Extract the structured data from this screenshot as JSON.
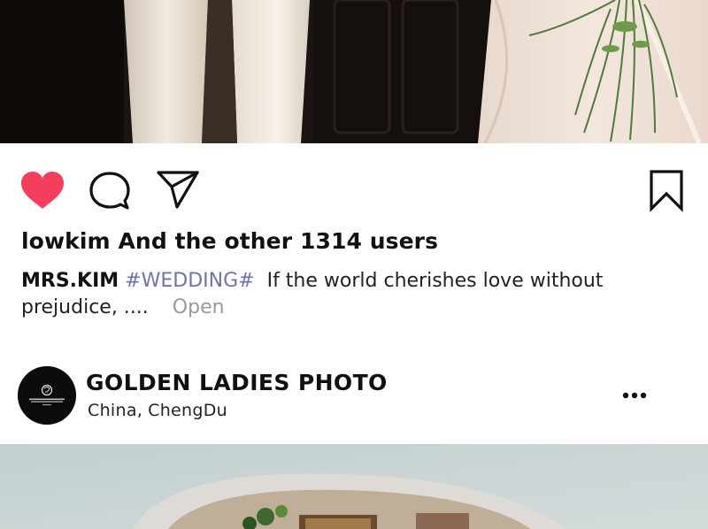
{
  "post1": {
    "photo": {
      "alt": "wedding-dress-photo",
      "icon": "photo-image"
    },
    "actions": {
      "like": {
        "icon": "heart-icon",
        "liked": true,
        "color": "#f23f5e"
      },
      "comment": {
        "icon": "comment-icon"
      },
      "share": {
        "icon": "send-icon"
      },
      "save": {
        "icon": "bookmark-icon"
      }
    },
    "likes_text": "lowkim And the other 1314 users",
    "caption": {
      "username": "MRS.KIM",
      "hashtag": "#WEDDING#",
      "text": "If the world cherishes love without prejudice, ....",
      "open_label": "Open"
    }
  },
  "post2": {
    "author": {
      "name": "GOLDEN LADIES PHOTO",
      "avatar_logo_text": "GOLDEN LADIES",
      "location_country": "China,",
      "location_city": "ChengDu"
    },
    "more": {
      "icon": "more-dots-icon"
    },
    "photo": {
      "alt": "arched-doorway-photo"
    }
  },
  "colors": {
    "accent_like": "#f23f5e",
    "hashtag": "#6e74a6",
    "muted": "#9a9a9a",
    "text": "#111111"
  }
}
